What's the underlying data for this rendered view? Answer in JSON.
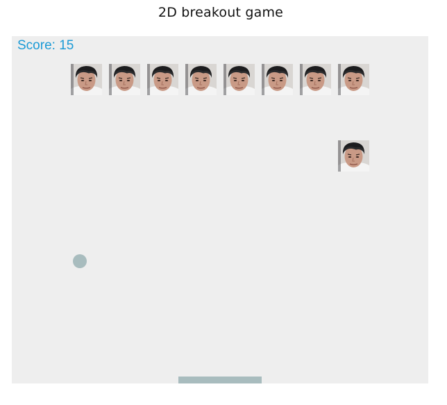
{
  "page": {
    "title": "2D breakout game"
  },
  "game": {
    "score_text": "Score: 15",
    "score": 15,
    "brick_icon": "face-photo-icon",
    "colors": {
      "canvas_bg": "#eeeeee",
      "score_text": "#1a9ad6",
      "ball": "#a8bcbe",
      "paddle": "#a8bcbe"
    }
  }
}
